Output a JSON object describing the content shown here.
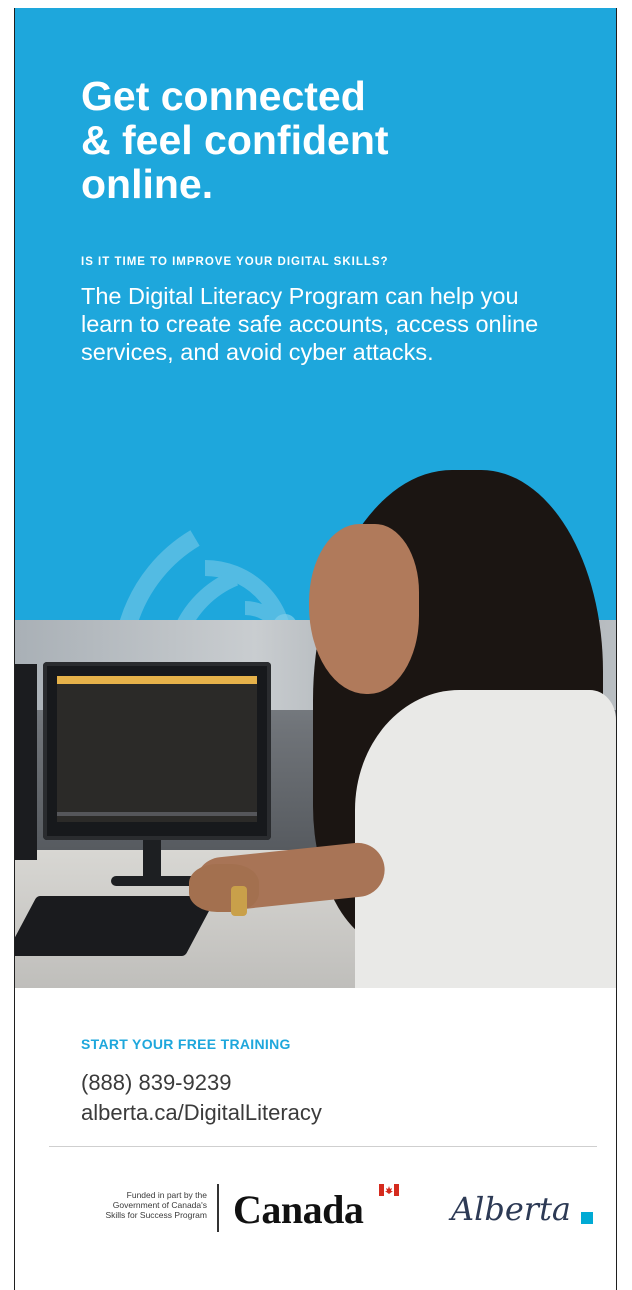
{
  "hero": {
    "headline_lines": [
      "Get connected",
      "& feel confident",
      "online."
    ],
    "eyebrow": "IS IT TIME TO IMPROVE YOUR DIGITAL SKILLS?",
    "intro": "The Digital Literacy Program can help you learn to create safe accounts, access online services, and avoid cyber attacks."
  },
  "photo": {
    "icon": "wifi-signal-icon"
  },
  "footer": {
    "cta_label": "START YOUR FREE TRAINING",
    "phone": "(888) 839-9239",
    "url": "alberta.ca/DigitalLiteracy",
    "funded_lines": [
      "Funded in part by the",
      "Government of Canada's",
      "Skills for Success Program"
    ],
    "canada_wordmark": "Canada",
    "alberta_wordmark": "Alberta"
  },
  "colors": {
    "brand_blue": "#1ea7dc",
    "text_dark": "#3b3b3b",
    "flag_red": "#d52b1e",
    "alberta_blue": "#00aad4"
  }
}
